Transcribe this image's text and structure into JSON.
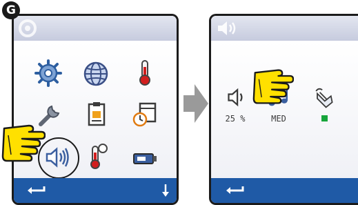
{
  "step_label": "G",
  "screen1": {
    "menu_items": [
      {
        "icon": "settings-wheel-icon"
      },
      {
        "icon": "globe-icon"
      },
      {
        "icon": "thermometer-icon"
      },
      {
        "icon": "wrench-icon"
      },
      {
        "icon": "clipboard-icon"
      },
      {
        "icon": "clock-calendar-icon"
      },
      {
        "icon": "speaker-icon",
        "highlighted": true
      },
      {
        "icon": "temperature-alarm-icon"
      },
      {
        "icon": "usb-stick-icon"
      }
    ],
    "bottom_bar": {
      "left_icon": "back-arrow-icon",
      "right_icon": "down-arrow-icon"
    }
  },
  "screen2": {
    "header_icon": "speaker-icon",
    "settings": [
      {
        "icon": "speaker-icon",
        "value": "25 %"
      },
      {
        "icon": "music-note-icon",
        "value": "MED"
      },
      {
        "icon": "touch-key-icon",
        "status_color": "#17a53b"
      }
    ],
    "bottom_bar": {
      "left_icon": "back-arrow-icon"
    }
  },
  "colors": {
    "bar_blue": "#1f5aa6",
    "hand_yellow": "#ffe000",
    "arrow_gray": "#9a9a9a"
  }
}
